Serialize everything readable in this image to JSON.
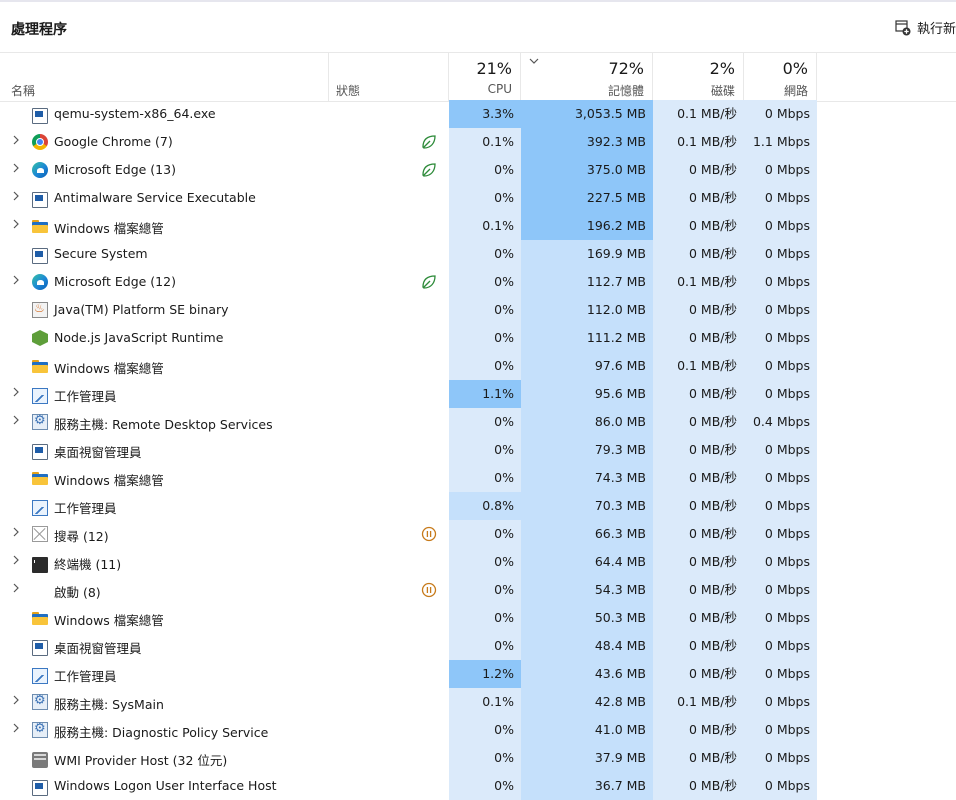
{
  "page": {
    "title": "處理程序",
    "run_task_label": "執行新"
  },
  "columns": {
    "name": "名稱",
    "status": "狀態",
    "cpu": {
      "percent": "21%",
      "label": "CPU"
    },
    "memory": {
      "percent": "72%",
      "label": "記憶體"
    },
    "disk": {
      "percent": "2%",
      "label": "磁碟"
    },
    "network": {
      "percent": "0%",
      "label": "網路"
    }
  },
  "processes": [
    {
      "name": "qemu-system-x86_64.exe",
      "icon": "app-window-icon",
      "expandable": false,
      "status": "",
      "cpu": "3.3%",
      "memory": "3,053.5 MB",
      "disk": "0.1 MB/秒",
      "network": "0 Mbps",
      "cpu_heat": 3,
      "mem_heat": 3
    },
    {
      "name": "Google Chrome (7)",
      "icon": "chrome-icon",
      "expandable": true,
      "status": "efficiency",
      "cpu": "0.1%",
      "memory": "392.3 MB",
      "disk": "0.1 MB/秒",
      "network": "1.1 Mbps",
      "cpu_heat": 1,
      "mem_heat": 3
    },
    {
      "name": "Microsoft Edge (13)",
      "icon": "edge-icon",
      "expandable": true,
      "status": "efficiency",
      "cpu": "0%",
      "memory": "375.0 MB",
      "disk": "0 MB/秒",
      "network": "0 Mbps",
      "cpu_heat": 1,
      "mem_heat": 3
    },
    {
      "name": "Antimalware Service Executable",
      "icon": "app-window-icon",
      "expandable": true,
      "status": "",
      "cpu": "0%",
      "memory": "227.5 MB",
      "disk": "0 MB/秒",
      "network": "0 Mbps",
      "cpu_heat": 1,
      "mem_heat": 3
    },
    {
      "name": "Windows 檔案總管",
      "icon": "folder-icon",
      "expandable": true,
      "status": "",
      "cpu": "0.1%",
      "memory": "196.2 MB",
      "disk": "0 MB/秒",
      "network": "0 Mbps",
      "cpu_heat": 1,
      "mem_heat": 3
    },
    {
      "name": "Secure System",
      "icon": "app-window-icon",
      "expandable": false,
      "status": "",
      "cpu": "0%",
      "memory": "169.9 MB",
      "disk": "0 MB/秒",
      "network": "0 Mbps",
      "cpu_heat": 1,
      "mem_heat": 2
    },
    {
      "name": "Microsoft Edge (12)",
      "icon": "edge-icon",
      "expandable": true,
      "status": "efficiency",
      "cpu": "0%",
      "memory": "112.7 MB",
      "disk": "0.1 MB/秒",
      "network": "0 Mbps",
      "cpu_heat": 1,
      "mem_heat": 2
    },
    {
      "name": "Java(TM) Platform SE binary",
      "icon": "java-icon",
      "expandable": false,
      "status": "",
      "cpu": "0%",
      "memory": "112.0 MB",
      "disk": "0 MB/秒",
      "network": "0 Mbps",
      "cpu_heat": 1,
      "mem_heat": 2
    },
    {
      "name": "Node.js JavaScript Runtime",
      "icon": "nodejs-icon",
      "expandable": false,
      "status": "",
      "cpu": "0%",
      "memory": "111.2 MB",
      "disk": "0 MB/秒",
      "network": "0 Mbps",
      "cpu_heat": 1,
      "mem_heat": 2
    },
    {
      "name": "Windows 檔案總管",
      "icon": "folder-icon",
      "expandable": false,
      "status": "",
      "cpu": "0%",
      "memory": "97.6 MB",
      "disk": "0.1 MB/秒",
      "network": "0 Mbps",
      "cpu_heat": 1,
      "mem_heat": 2
    },
    {
      "name": "工作管理員",
      "icon": "task-manager-icon",
      "expandable": true,
      "status": "",
      "cpu": "1.1%",
      "memory": "95.6 MB",
      "disk": "0 MB/秒",
      "network": "0 Mbps",
      "cpu_heat": 3,
      "mem_heat": 2
    },
    {
      "name": "服務主機: Remote Desktop Services",
      "icon": "service-gear-icon",
      "expandable": true,
      "status": "",
      "cpu": "0%",
      "memory": "86.0 MB",
      "disk": "0 MB/秒",
      "network": "0.4 Mbps",
      "cpu_heat": 1,
      "mem_heat": 2
    },
    {
      "name": "桌面視窗管理員",
      "icon": "app-window-icon",
      "expandable": false,
      "status": "",
      "cpu": "0%",
      "memory": "79.3 MB",
      "disk": "0 MB/秒",
      "network": "0 Mbps",
      "cpu_heat": 1,
      "mem_heat": 2
    },
    {
      "name": "Windows 檔案總管",
      "icon": "folder-icon",
      "expandable": false,
      "status": "",
      "cpu": "0%",
      "memory": "74.3 MB",
      "disk": "0 MB/秒",
      "network": "0 Mbps",
      "cpu_heat": 1,
      "mem_heat": 2
    },
    {
      "name": "工作管理員",
      "icon": "task-manager-icon",
      "expandable": false,
      "status": "",
      "cpu": "0.8%",
      "memory": "70.3 MB",
      "disk": "0 MB/秒",
      "network": "0 Mbps",
      "cpu_heat": 2,
      "mem_heat": 2
    },
    {
      "name": "搜尋 (12)",
      "icon": "search-placeholder-icon",
      "expandable": true,
      "status": "suspended",
      "cpu": "0%",
      "memory": "66.3 MB",
      "disk": "0 MB/秒",
      "network": "0 Mbps",
      "cpu_heat": 1,
      "mem_heat": 2
    },
    {
      "name": "終端機 (11)",
      "icon": "terminal-icon",
      "expandable": true,
      "status": "",
      "cpu": "0%",
      "memory": "64.4 MB",
      "disk": "0 MB/秒",
      "network": "0 Mbps",
      "cpu_heat": 1,
      "mem_heat": 2
    },
    {
      "name": "啟動 (8)",
      "icon": "",
      "expandable": true,
      "status": "suspended",
      "cpu": "0%",
      "memory": "54.3 MB",
      "disk": "0 MB/秒",
      "network": "0 Mbps",
      "cpu_heat": 1,
      "mem_heat": 2
    },
    {
      "name": "Windows 檔案總管",
      "icon": "folder-icon",
      "expandable": false,
      "status": "",
      "cpu": "0%",
      "memory": "50.3 MB",
      "disk": "0 MB/秒",
      "network": "0 Mbps",
      "cpu_heat": 1,
      "mem_heat": 2
    },
    {
      "name": "桌面視窗管理員",
      "icon": "app-window-icon",
      "expandable": false,
      "status": "",
      "cpu": "0%",
      "memory": "48.4 MB",
      "disk": "0 MB/秒",
      "network": "0 Mbps",
      "cpu_heat": 1,
      "mem_heat": 2
    },
    {
      "name": "工作管理員",
      "icon": "task-manager-icon",
      "expandable": false,
      "status": "",
      "cpu": "1.2%",
      "memory": "43.6 MB",
      "disk": "0 MB/秒",
      "network": "0 Mbps",
      "cpu_heat": 3,
      "mem_heat": 2
    },
    {
      "name": "服務主機: SysMain",
      "icon": "service-gear-icon",
      "expandable": true,
      "status": "",
      "cpu": "0.1%",
      "memory": "42.8 MB",
      "disk": "0.1 MB/秒",
      "network": "0 Mbps",
      "cpu_heat": 1,
      "mem_heat": 2
    },
    {
      "name": "服務主機: Diagnostic Policy Service",
      "icon": "service-gear-icon",
      "expandable": true,
      "status": "",
      "cpu": "0%",
      "memory": "41.0 MB",
      "disk": "0 MB/秒",
      "network": "0 Mbps",
      "cpu_heat": 1,
      "mem_heat": 2
    },
    {
      "name": "WMI Provider Host (32 位元)",
      "icon": "wmi-icon",
      "expandable": false,
      "status": "",
      "cpu": "0%",
      "memory": "37.9 MB",
      "disk": "0 MB/秒",
      "network": "0 Mbps",
      "cpu_heat": 1,
      "mem_heat": 2
    },
    {
      "name": "Windows Logon User Interface Host",
      "icon": "app-window-icon",
      "expandable": false,
      "status": "",
      "cpu": "0%",
      "memory": "36.7 MB",
      "disk": "0 MB/秒",
      "network": "0 Mbps",
      "cpu_heat": 1,
      "mem_heat": 2
    }
  ],
  "colors": {
    "heat_low": "#dbeafa",
    "heat_mid": "#c5e0fb",
    "heat_high": "#8ec6f9",
    "leaf": "#2e8b3a",
    "pause": "#c77a1a"
  }
}
